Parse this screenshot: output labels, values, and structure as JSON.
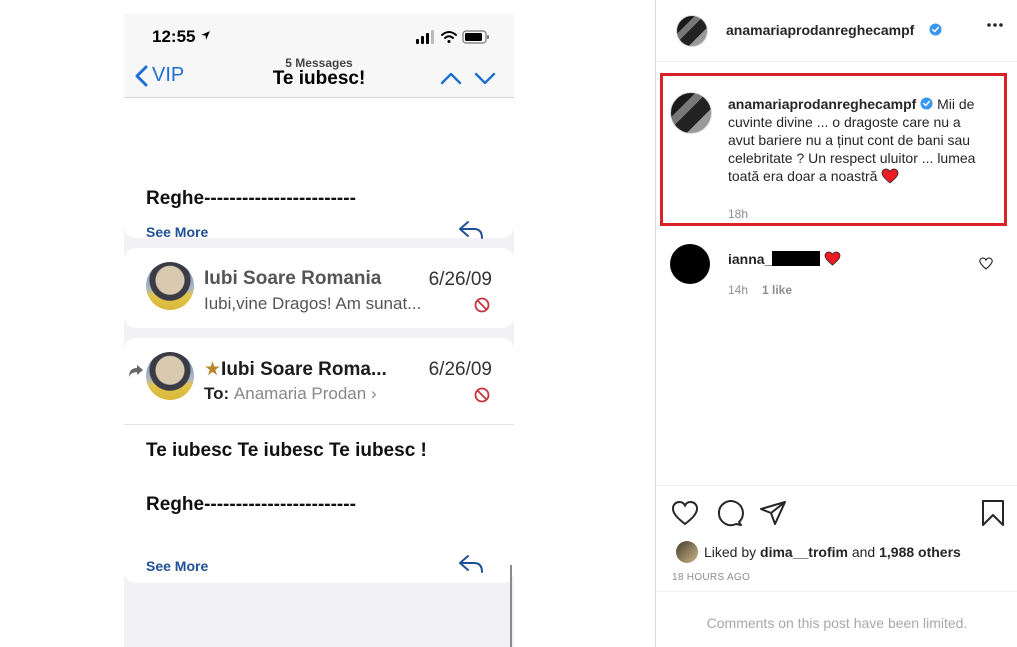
{
  "screenshot": {
    "status_time": "12:55",
    "back_label": "VIP",
    "message_count": "5 Messages",
    "thread_subject": "Te iubesc!",
    "card1": {
      "body": "Reghe------------------------",
      "see_more": "See More"
    },
    "message2": {
      "sender": "Iubi Soare Romania",
      "date": "6/26/09",
      "preview": "Iubi,vine Dragos! Am sunat..."
    },
    "message3": {
      "star": "★",
      "sender": "Iubi Soare Roma...",
      "date": "6/26/09",
      "to_label": "To:",
      "to_name": "Anamaria  Prodan",
      "to_chevron": "›",
      "body_line1": "Te iubesc Te iubesc Te iubesc !",
      "body_line2": "Reghe------------------------",
      "see_more": "See More"
    }
  },
  "post": {
    "author": "anamariaprodanreghecampf",
    "caption_author": "anamariaprodanreghecampf",
    "caption_text": "Mii de cuvinte divine ... o dragoste care nu a avut bariere nu a ținut cont de bani sau celebritate ? Un respect uluitor ... lumea toată era doar a noastră",
    "caption_time": "18h",
    "comment": {
      "username": "ianna_",
      "time": "14h",
      "likes": "1 like"
    },
    "liked_by_prefix": "Liked by",
    "liked_by_user": "dima__trofim",
    "liked_by_and": "and",
    "liked_by_others": "1,988 others",
    "time_ago": "18 HOURS AGO",
    "comments_limited": "Comments on this post have been limited."
  },
  "colors": {
    "ios_blue": "#1f6fd1",
    "highlight_red": "#d8222a",
    "verified_blue": "#3897f0",
    "heart_red": "#ed1c24"
  },
  "icons": [
    "location-arrow-icon",
    "signal-icon",
    "wifi-icon",
    "battery-icon",
    "back-chevron-icon",
    "up-chevron-icon",
    "down-chevron-icon",
    "reply-icon",
    "no-entry-icon",
    "forward-arrow-icon",
    "verified-icon",
    "more-icon",
    "heart-icon",
    "comment-icon",
    "share-icon",
    "bookmark-icon"
  ]
}
